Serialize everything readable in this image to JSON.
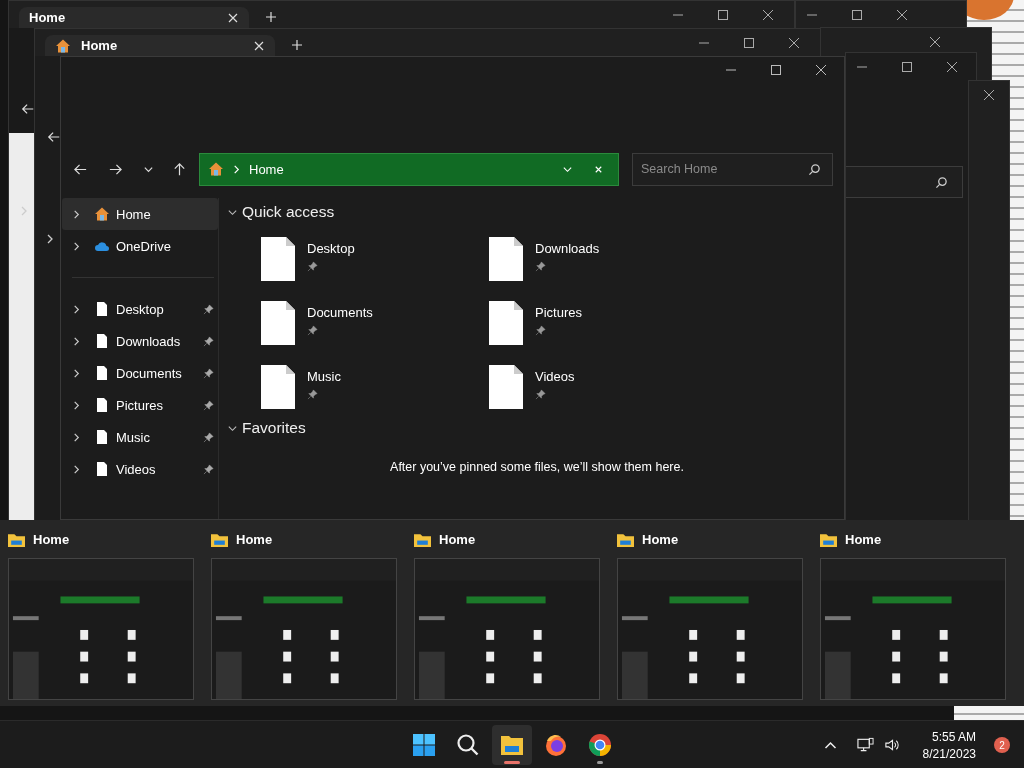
{
  "back_windows": [
    {
      "tab": "Home",
      "home_icon": false
    },
    {
      "tab": "Home",
      "home_icon": true
    }
  ],
  "main": {
    "address": {
      "location": "Home"
    },
    "search": {
      "placeholder": "Search Home"
    },
    "sidebar": {
      "items": [
        {
          "label": "Home",
          "kind": "home",
          "selected": true,
          "pinned": false
        },
        {
          "label": "OneDrive",
          "kind": "cloud",
          "selected": false,
          "pinned": false
        },
        {
          "label": "Desktop",
          "kind": "folder",
          "selected": false,
          "pinned": true
        },
        {
          "label": "Downloads",
          "kind": "folder",
          "selected": false,
          "pinned": true
        },
        {
          "label": "Documents",
          "kind": "folder",
          "selected": false,
          "pinned": true
        },
        {
          "label": "Pictures",
          "kind": "folder",
          "selected": false,
          "pinned": true
        },
        {
          "label": "Music",
          "kind": "folder",
          "selected": false,
          "pinned": true
        },
        {
          "label": "Videos",
          "kind": "folder",
          "selected": false,
          "pinned": true
        }
      ]
    },
    "quick_access": {
      "title": "Quick access",
      "expanded": true,
      "items": [
        {
          "name": "Desktop",
          "pinned": true
        },
        {
          "name": "Downloads",
          "pinned": true
        },
        {
          "name": "Documents",
          "pinned": true
        },
        {
          "name": "Pictures",
          "pinned": true
        },
        {
          "name": "Music",
          "pinned": true
        },
        {
          "name": "Videos",
          "pinned": true
        }
      ]
    },
    "favorites": {
      "title": "Favorites",
      "expanded": true,
      "message": "After you’ve pinned some files, we’ll show them here."
    }
  },
  "switcher": [
    {
      "title": "Home"
    },
    {
      "title": "Home"
    },
    {
      "title": "Home"
    },
    {
      "title": "Home"
    },
    {
      "title": "Home"
    }
  ],
  "taskbar": {
    "apps": [
      {
        "kind": "start",
        "active": false,
        "running": false
      },
      {
        "kind": "search",
        "active": false,
        "running": false
      },
      {
        "kind": "explorer",
        "active": true,
        "running": true
      },
      {
        "kind": "firefox",
        "active": false,
        "running": false
      },
      {
        "kind": "chrome",
        "active": false,
        "running": true
      }
    ],
    "time": "5:55 AM",
    "date": "8/21/2023",
    "notifications": "2"
  }
}
